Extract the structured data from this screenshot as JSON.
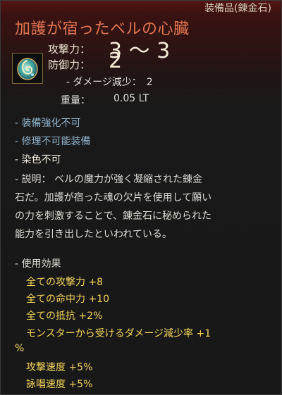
{
  "item": {
    "type_label": "装備品(錬金石)",
    "name": "加護が宿ったベルの心臓",
    "icon": "gem-icon"
  },
  "stats": {
    "attack_label": "攻撃力：",
    "attack_value": "3 ～ 3",
    "defense_label": "防御力：",
    "defense_value": "2",
    "damage_reduction": "- ダメージ減少：　2",
    "weight_label": "重量：",
    "weight_value": "0.05 LT"
  },
  "properties": [
    "- 装備強化不可",
    "- 修理不可能装備",
    "- 染色不可"
  ],
  "description": {
    "lines": [
      "- 説明：  ベルの魔力が強く凝縮された錬金",
      "石だ。加護が宿った魂の欠片を使用して願い",
      "の力を刺激することで、錬金石に秘められた",
      "能力を引き出したといわれている。"
    ]
  },
  "effects": {
    "header": "- 使用効果",
    "items": [
      "全ての攻撃力 +8",
      "全ての命中力 +10",
      "全ての抵抗 +2%",
      "モンスターから受けるダメージ減少率 +1",
      "%",
      "攻撃速度 +5%",
      "詠唱速度 +5%"
    ]
  },
  "colors": {
    "name": "#e0754f",
    "property_blue": "#8fb3cd",
    "effect_yellow": "#f3d55a"
  }
}
